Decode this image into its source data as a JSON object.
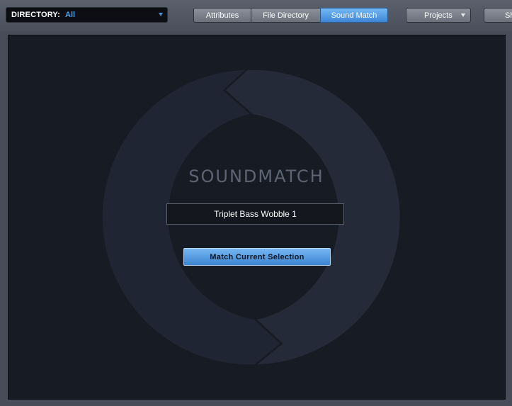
{
  "directory": {
    "label": "DIRECTORY:",
    "value": "All"
  },
  "tabs": [
    {
      "label": "Attributes",
      "active": false
    },
    {
      "label": "File Directory",
      "active": false
    },
    {
      "label": "Sound Match",
      "active": true
    }
  ],
  "projects": {
    "label": "Projects"
  },
  "show": {
    "label": "Show"
  },
  "soundmatch": {
    "title": "SOUNDMATCH",
    "current_sound": "Triplet Bass Wobble 1",
    "match_button": "Match Current Selection"
  },
  "colors": {
    "accent": "#4a9be8",
    "panel_bg": "#171b24",
    "ring": "#242a37"
  },
  "icons": {
    "directory_dropdown": "chevron-down-icon",
    "projects_dropdown": "chevron-down-icon"
  }
}
